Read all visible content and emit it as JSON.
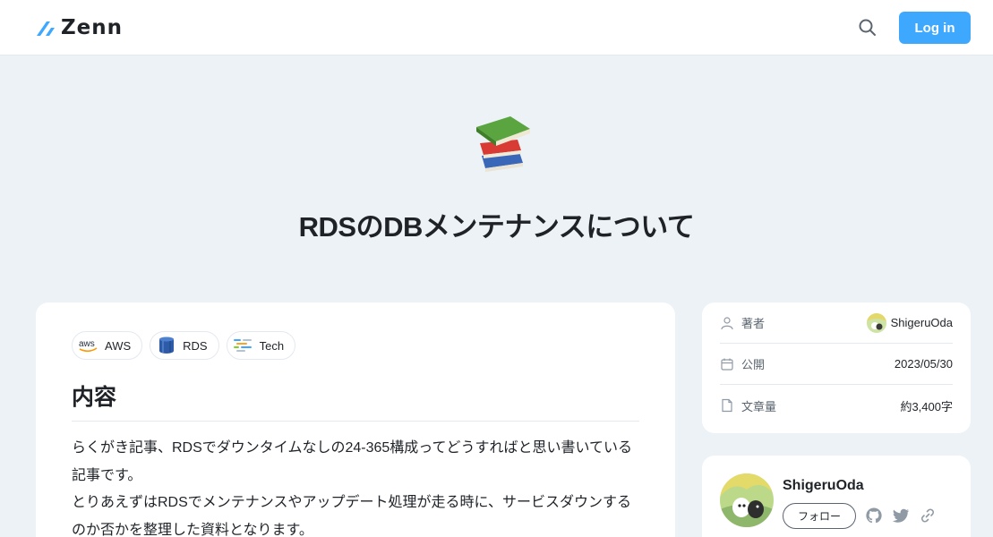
{
  "header": {
    "logo_text": "Zenn",
    "login_label": "Log in"
  },
  "article": {
    "emoji": "books",
    "title": "RDSのDBメンテナンスについて",
    "tags": [
      {
        "label": "AWS",
        "icon": "aws-icon"
      },
      {
        "label": "RDS",
        "icon": "rds-icon"
      },
      {
        "label": "Tech",
        "icon": "tech-icon"
      }
    ],
    "section_heading": "内容",
    "paragraphs": [
      "らくがき記事、RDSでダウンタイムなしの24-365構成ってどうすればと思い書いている記事です。",
      "とりあえずはRDSでメンテナンスやアップデート処理が走る時に、サービスダウンするのか否かを整理した資料となります。"
    ]
  },
  "meta": {
    "author_label": "著者",
    "author_name": "ShigeruOda",
    "published_label": "公開",
    "published_date": "2023/05/30",
    "length_label": "文章量",
    "length_value": "約3,400字"
  },
  "author_card": {
    "name": "ShigeruOda",
    "follow_label": "フォロー"
  },
  "colors": {
    "accent": "#3ea8ff",
    "background": "#edf2f7",
    "text": "#1f2328"
  }
}
